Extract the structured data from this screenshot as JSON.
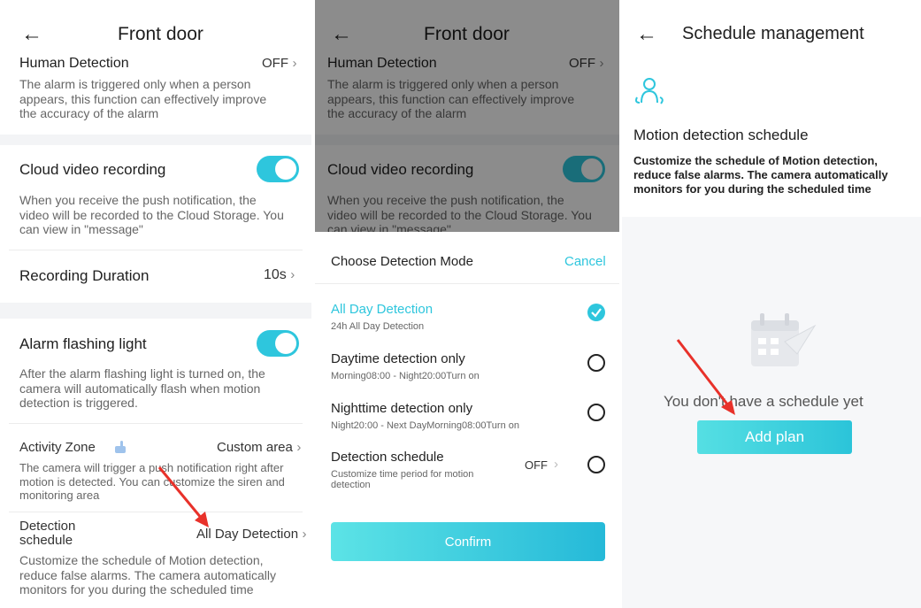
{
  "left_screen": {
    "back_icon": "←",
    "title": "Front door",
    "human_detection": {
      "label": "Human Detection",
      "value": "OFF",
      "chevron": "›",
      "desc": [
        "The alarm is triggered only when a person",
        "appears, this function can effectively improve",
        "the accuracy of the alarm"
      ]
    },
    "cloud_recording": {
      "label": "Cloud video recording",
      "enabled": true,
      "desc": [
        "When you receive the push notification, the",
        "video will be recorded to the Cloud Storage. You",
        "can view in \"message\""
      ]
    },
    "recording_duration": {
      "label": "Recording Duration",
      "value": "10s",
      "chevron": "›"
    },
    "alarm_light": {
      "label": "Alarm flashing light",
      "enabled": true,
      "desc": [
        "After the alarm flashing light is turned on, the",
        "camera will automatically flash when motion",
        "detection is triggered."
      ]
    },
    "activity_zone": {
      "label": "Activity Zone",
      "value": "Custom area",
      "chevron": "›",
      "desc": [
        "The camera will trigger a push notification right after",
        "motion is detected. You can customize the siren and",
        "monitoring area"
      ]
    },
    "detection_schedule": {
      "label_lines": [
        "Detection",
        "schedule"
      ],
      "value": "All Day Detection",
      "chevron": "›",
      "desc": [
        "Customize the schedule of Motion detection,",
        "reduce false alarms. The camera automatically",
        "monitors for you during the scheduled time"
      ]
    }
  },
  "middle_screen": {
    "sheet_title": "Choose Detection Mode",
    "cancel": "Cancel",
    "options": [
      {
        "title": "All Day Detection",
        "subtitle": "24h All Day Detection",
        "selected": true
      },
      {
        "title": "Daytime detection only",
        "subtitle": "Morning08:00 - Night20:00Turn on",
        "selected": false
      },
      {
        "title": "Nighttime detection only",
        "subtitle": "Night20:00 - Next DayMorning08:00Turn on",
        "selected": false
      },
      {
        "title": "Detection schedule",
        "subtitle_lines": [
          "Customize time period for motion",
          "detection"
        ],
        "value": "OFF",
        "chevron": "›",
        "selected": false
      }
    ],
    "confirm": "Confirm"
  },
  "right_screen": {
    "back_icon": "←",
    "title": "Schedule management",
    "section_title": "Motion detection schedule",
    "section_desc": [
      "Customize the schedule of Motion detection,",
      "reduce false alarms. The camera automatically",
      "monitors for you during the scheduled time"
    ],
    "empty_text": "You don't have a schedule yet",
    "add_plan": "Add plan"
  },
  "colors": {
    "accent": "#2ec6dd",
    "arrow": "#e8312a",
    "section_bg": "#f3f4f6"
  }
}
